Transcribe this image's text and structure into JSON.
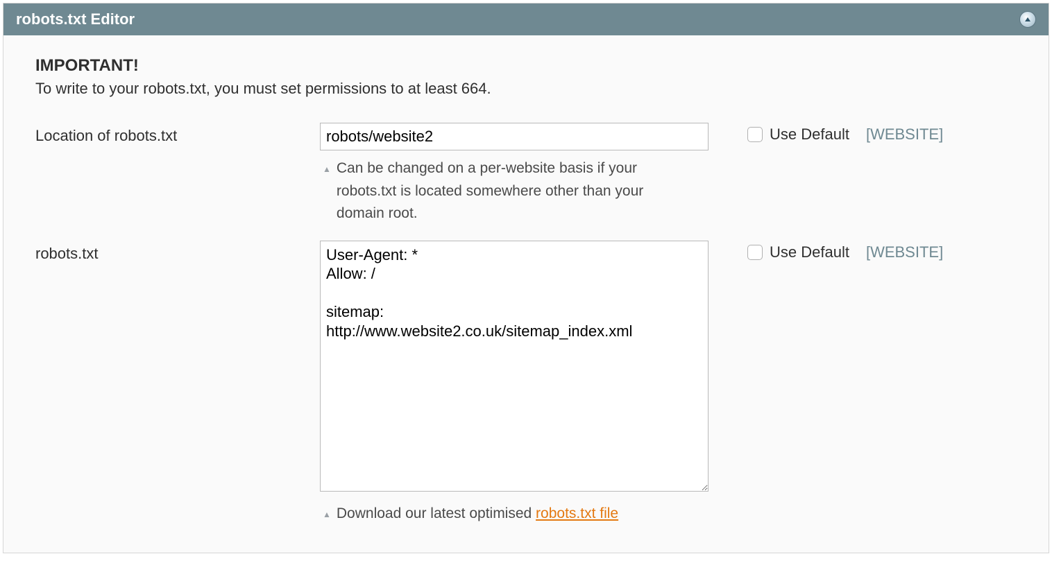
{
  "header": {
    "title": "robots.txt Editor"
  },
  "notice": {
    "title": "IMPORTANT!",
    "text": "To write to your robots.txt, you must set permissions to at least 664."
  },
  "fields": {
    "location": {
      "label": "Location of robots.txt",
      "value": "robots/website2",
      "hint": "Can be changed on a per-website basis if your robots.txt is located somewhere other than your domain root.",
      "use_default_label": "Use Default",
      "scope": "[WEBSITE]"
    },
    "robots": {
      "label": "robots.txt",
      "value": "User-Agent: *\nAllow: /\n\nsitemap:\nhttp://www.website2.co.uk/sitemap_index.xml",
      "hint_prefix": "Download our latest optimised ",
      "hint_link": "robots.txt file",
      "use_default_label": "Use Default",
      "scope": "[WEBSITE]"
    }
  }
}
